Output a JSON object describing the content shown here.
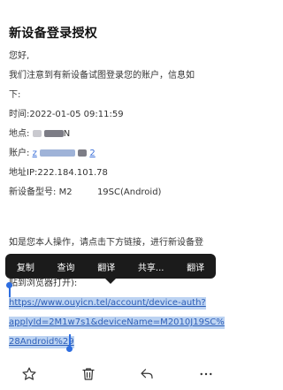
{
  "email": {
    "title": "新设备登录授权",
    "greeting": "您好,",
    "intro_line1": "我们注意到有新设备试图登录您的账户，信息如",
    "intro_line2": "下:",
    "time_label": "时间:",
    "time_value": "2022-01-05 09:11:59",
    "location_label": "地点:",
    "location_suffix": "N",
    "account_label": "账户:",
    "account_prefix": "z",
    "account_suffix": "2",
    "ip_label": "地址IP:",
    "ip_value": "222.184.101.78",
    "model_label": "新设备型号:",
    "model_prefix": "M2",
    "model_suffix": "19SC(Android)",
    "action_line1": "如是您本人操作，请点击下方链接，进行新设备登",
    "action_line2": "贴到浏览器打开):",
    "link_line1": "https://www.ouyicn.tel/account/device-auth?",
    "link_line2": "applyId=2M1w7s1&deviceName=M2010J19SC%",
    "link_line3": "28Android%29"
  },
  "tooltip": {
    "items": [
      "复制",
      "查询",
      "翻译",
      "共享...",
      "翻译"
    ]
  },
  "toolbar": {
    "icons": [
      "star-icon",
      "trash-icon",
      "reply-icon",
      "more-icon"
    ]
  },
  "colors": {
    "selection": "#bcd3f2",
    "handle": "#2d6de0",
    "tooltip_bg": "#1b1b1b",
    "link": "#2e5fb8"
  }
}
